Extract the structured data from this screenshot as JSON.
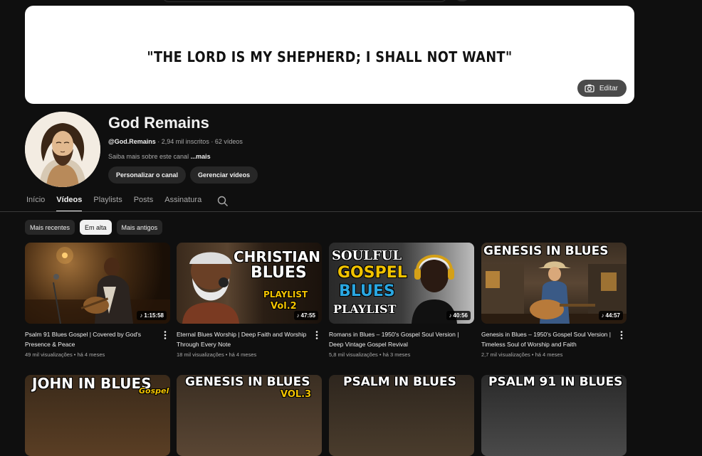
{
  "banner": {
    "quote": "\"THE LORD IS MY SHEPHERD; I SHALL NOT WANT\"",
    "edit_label": "Editar"
  },
  "channel": {
    "name": "God Remains",
    "handle": "@God.Remains",
    "stats": " · 2,94 mil inscritos · 62 vídeos",
    "about": "Saiba mais sobre este canal ",
    "about_more": "...mais",
    "customize_label": "Personalizar o canal",
    "manage_label": "Gerenciar vídeos"
  },
  "tabs": [
    {
      "label": "Início",
      "active": false
    },
    {
      "label": "Vídeos",
      "active": true
    },
    {
      "label": "Playlists",
      "active": false
    },
    {
      "label": "Posts",
      "active": false
    },
    {
      "label": "Assinatura",
      "active": false
    }
  ],
  "chips": [
    {
      "label": "Mais recentes",
      "active": false
    },
    {
      "label": "Em alta",
      "active": true
    },
    {
      "label": "Mais antigos",
      "active": false
    }
  ],
  "videos": [
    {
      "title": "Psalm 91 Blues Gospel | Covered by God's Presence & Peace",
      "views": "49 mil visualizações",
      "age": "há 4 meses",
      "duration": "1:15:58",
      "thumb_text": []
    },
    {
      "title": "Eternal Blues Worship | Deep Faith and Worship Through Every Note",
      "views": "18 mil visualizações",
      "age": "há 4 meses",
      "duration": "47:55",
      "thumb_text": [
        "CHRISTIAN",
        "BLUES",
        "PLAYLIST",
        "Vol.2"
      ]
    },
    {
      "title": "Romans in Blues – 1950's Gospel Soul Version | Deep Vintage Gospel Revival",
      "views": "5,8 mil visualizações",
      "age": "há 3 meses",
      "duration": "40:56",
      "thumb_text": [
        "SOULFUL",
        "GOSPEL",
        "BLUES",
        "PLAYLIST"
      ]
    },
    {
      "title": "Genesis in Blues – 1950's Gospel Soul Version | Timeless Soul of Worship and Faith",
      "views": "2,7 mil visualizações",
      "age": "há 4 meses",
      "duration": "44:57",
      "thumb_text": [
        "GENESIS IN BLUES"
      ]
    }
  ],
  "videos_row2": [
    {
      "thumb_text": [
        "JOHN IN BLUES",
        "Gospel"
      ]
    },
    {
      "thumb_text": [
        "GENESIS IN BLUES",
        "VOL.3"
      ]
    },
    {
      "thumb_text": [
        "PSALM IN BLUES"
      ]
    },
    {
      "thumb_text": [
        "PSALM 91 IN BLUES"
      ]
    }
  ],
  "meta_separator": " • ",
  "colors": {
    "background": "#0f0f0f",
    "text": "#f1f1f1",
    "secondary_text": "#aaaaaa",
    "chip": "#272727",
    "gold": "#f2c300"
  },
  "icons": {
    "edit": "camera-icon",
    "search": "search-icon",
    "menu": "more-vert-icon",
    "duration": "music-note-icon"
  }
}
